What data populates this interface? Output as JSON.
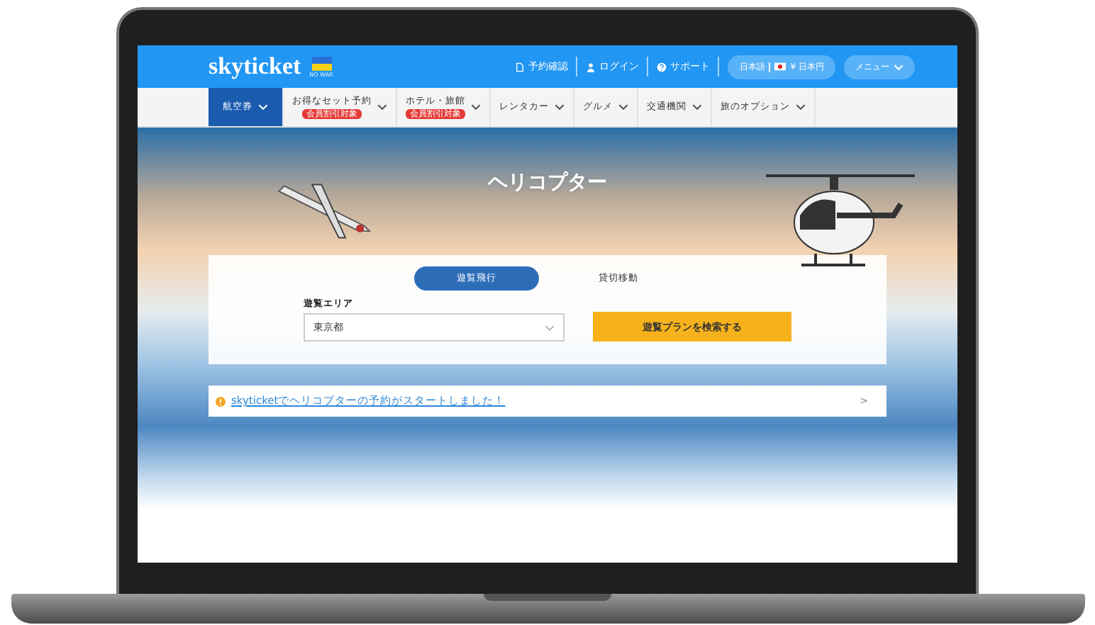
{
  "header": {
    "logo": "skyticket",
    "logo_badge": "NO WAR",
    "links": [
      "予約確認",
      "ログイン",
      "サポート"
    ],
    "language": {
      "language": "日本語",
      "currency": "¥ 日本円"
    },
    "menu": "メニュー"
  },
  "nav": [
    {
      "label": "航空券",
      "selected": true
    },
    {
      "label": "お得なセット予約",
      "selected": false,
      "badge": "会員割引対象"
    },
    {
      "label": "ホテル・旅館",
      "selected": false,
      "badge": "会員割引対象"
    },
    {
      "label": "レンタカー",
      "selected": false
    },
    {
      "label": "グルメ",
      "selected": false
    },
    {
      "label": "交通機関",
      "selected": false
    },
    {
      "label": "旅のオプション",
      "selected": false
    }
  ],
  "hero": {
    "title": "ヘリコプター"
  },
  "search": {
    "tabs": [
      {
        "label": "遊覧飛行",
        "selected": true
      },
      {
        "label": "貸切移動",
        "selected": false
      }
    ],
    "area_label": "遊覧エリア",
    "area_value": "東京都",
    "button": "遊覧プランを検索する"
  },
  "notice": {
    "link": "skyticketでヘリコプターの予約がスタートしました！",
    "arrow": ">"
  }
}
